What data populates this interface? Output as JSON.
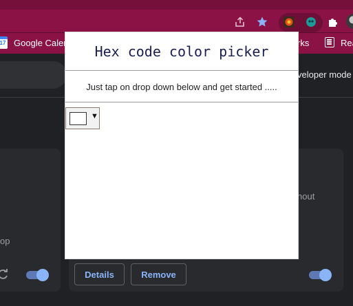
{
  "browser": {
    "toolbar_icons": [
      "share-icon",
      "star-icon",
      "color-picker-extension-icon",
      "teal-extension-icon",
      "extensions-puzzle-icon",
      "profile-avatar"
    ],
    "accent_color": "#8a1244"
  },
  "bookmarks": {
    "items": [
      {
        "label": "Google Calenc",
        "icon": "calendar-icon",
        "icon_text": "17"
      },
      {
        "label": "rks"
      },
      {
        "label": "Rea",
        "icon": "reading-list-icon"
      }
    ]
  },
  "extensions_page": {
    "developer_mode_label": "veloper mode",
    "card_right_text": "nout",
    "card_left_text": "op",
    "details_button": "Details",
    "remove_button": "Remove",
    "toggle_left_on": true,
    "toggle_right_on": true
  },
  "popup": {
    "title": "Hex code color picker",
    "instructions": "Just tap on drop down below and get started .....",
    "selected_color": "#ffffff",
    "dropdown_arrow": "▼"
  }
}
